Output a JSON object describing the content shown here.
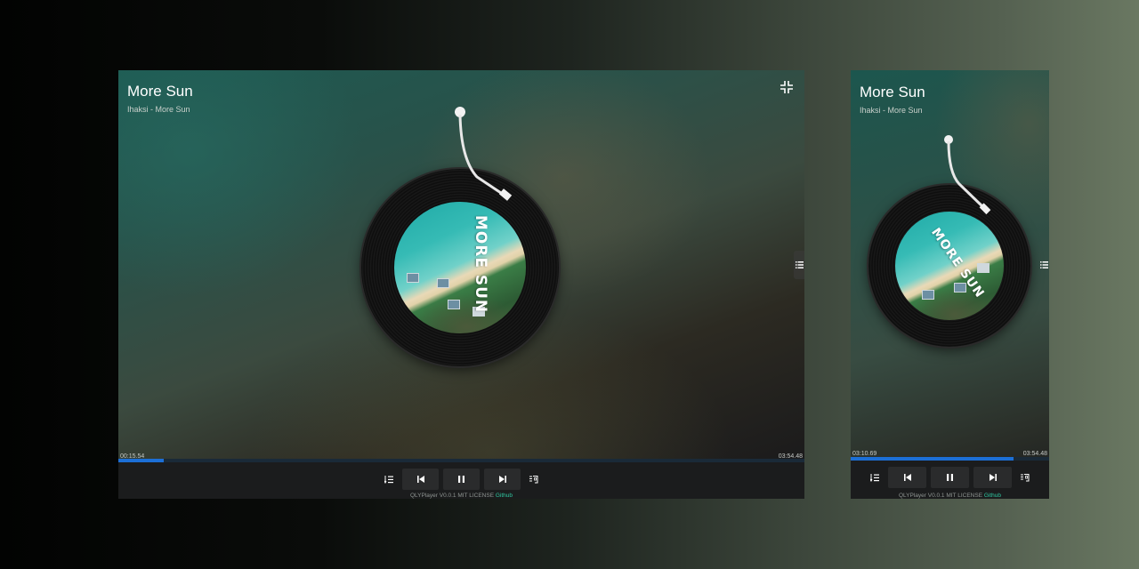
{
  "desktop": {
    "title": "More Sun",
    "subtitle": "Ihaksi - More Sun",
    "cover_text": "MORE SUN",
    "time_current": "00:15.54",
    "time_duration": "03:54.48",
    "progress": 0.066
  },
  "mobile": {
    "title": "More Sun",
    "subtitle": "Ihaksi - More Sun",
    "cover_text": "MORE SUN",
    "time_current": "03:10.69",
    "time_duration": "03:54.48",
    "progress": 0.82
  },
  "footer": {
    "text": "QLYPlayer V0.0.1 MIT LICENSE ",
    "link": "Github"
  },
  "icons": {
    "shrink": "shrink-icon",
    "list": "list-icon",
    "playlist": "playlist-icon",
    "previous": "previous-icon",
    "pause": "pause-icon",
    "next": "next-icon",
    "lyrics": "lyrics-icon"
  },
  "colors": {
    "progress": "#1c6fd6",
    "link": "#2fc7a0",
    "controls_bg": "#1b1c1d"
  }
}
